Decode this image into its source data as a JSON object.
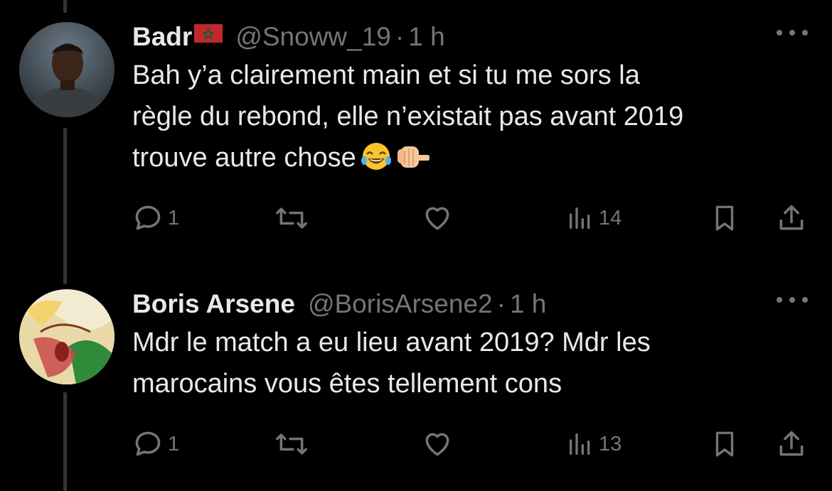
{
  "tweets": [
    {
      "display_name": "Badr",
      "flag": "morocco-flag",
      "handle": "@Snoww_19",
      "separator": "·",
      "time": "1 h",
      "text_lines": [
        "Bah y’a clairement main et si tu me sors la",
        "règle du rebond, elle n’existait pas avant 2019",
        "trouve autre chose"
      ],
      "emojis": [
        "tears-of-joy-emoji",
        "pointing-fist-emoji"
      ],
      "actions": {
        "replies": "1",
        "reposts": "",
        "likes": "",
        "views": "14"
      }
    },
    {
      "display_name": "Boris Arsene",
      "handle": "@BorisArsene2",
      "separator": "·",
      "time": "1 h",
      "text_lines": [
        "Mdr le match a eu lieu avant 2019? Mdr les",
        "marocains vous êtes tellement cons"
      ],
      "actions": {
        "replies": "1",
        "reposts": "",
        "likes": "",
        "views": "13"
      }
    }
  ],
  "colors": {
    "background": "#000000",
    "text": "#e7e9ea",
    "muted": "#71767b",
    "thread_line": "#333639"
  }
}
